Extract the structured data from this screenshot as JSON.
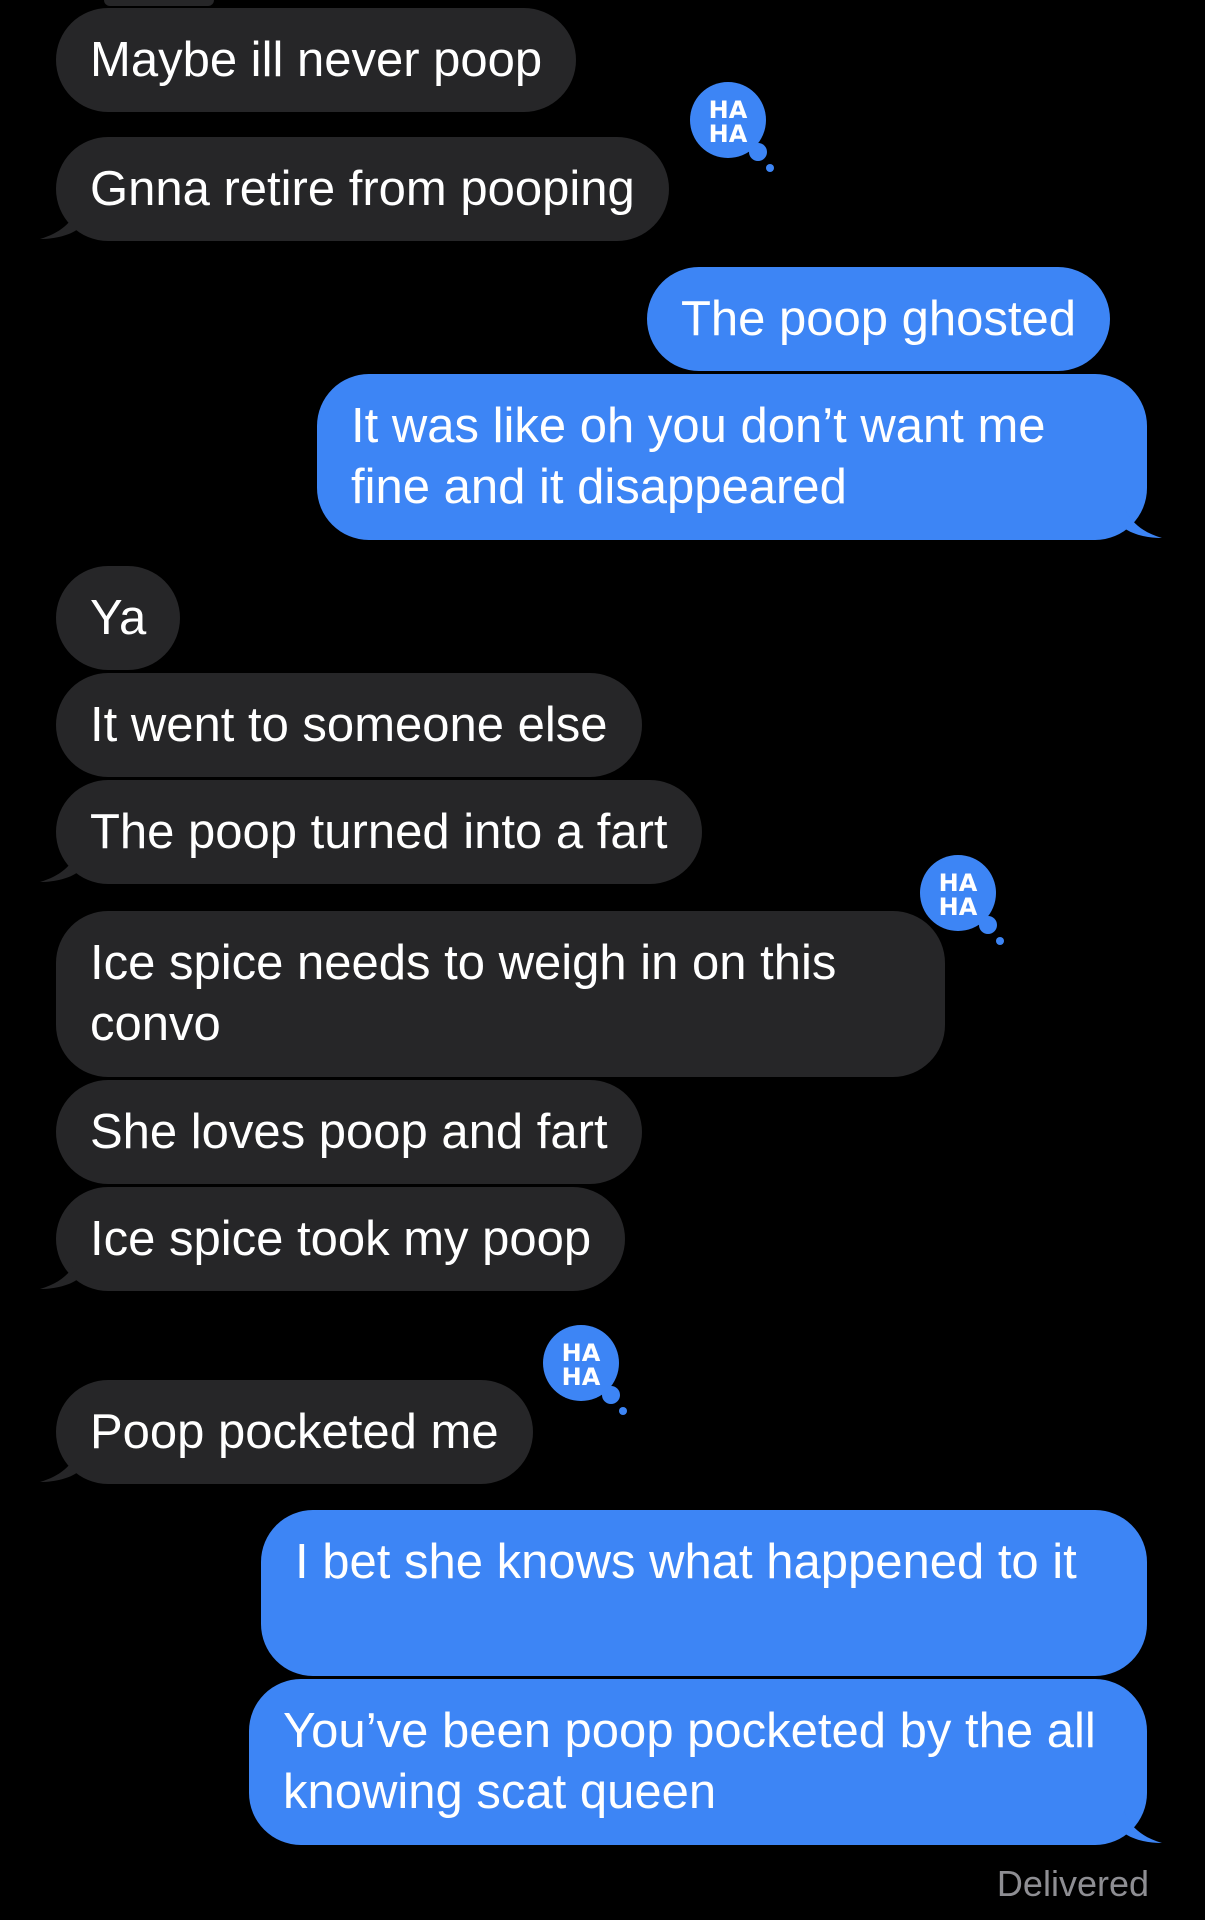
{
  "colors": {
    "background": "#000000",
    "incoming_bubble": "#262628",
    "outgoing_bubble": "#3d85f5",
    "text": "#ffffff",
    "delivered_text": "#8e8e93"
  },
  "messages": [
    {
      "text": "Maybe ill never poop",
      "direction": "incoming"
    },
    {
      "text": "Gnna retire from pooping",
      "direction": "incoming",
      "reaction": "haha"
    },
    {
      "text": "The poop ghosted",
      "direction": "outgoing"
    },
    {
      "text": "It was like oh you don’t want me fine and it disappeared",
      "direction": "outgoing"
    },
    {
      "text": "Ya",
      "direction": "incoming"
    },
    {
      "text": "It went to someone else",
      "direction": "incoming"
    },
    {
      "text": "The poop turned into a fart",
      "direction": "incoming"
    },
    {
      "text": "Ice spice needs to weigh in on this convo",
      "direction": "incoming",
      "reaction": "haha"
    },
    {
      "text": "She loves poop and fart",
      "direction": "incoming"
    },
    {
      "text": "Ice spice took my poop",
      "direction": "incoming"
    },
    {
      "text": "Poop pocketed me",
      "direction": "incoming",
      "reaction": "haha"
    },
    {
      "text": "I bet she knows what happened to it",
      "direction": "outgoing"
    },
    {
      "text": "You’ve been poop pocketed by the all knowing scat queen",
      "direction": "outgoing"
    }
  ],
  "reaction_label": {
    "line1": "HA",
    "line2": "HA"
  },
  "status": "Delivered"
}
